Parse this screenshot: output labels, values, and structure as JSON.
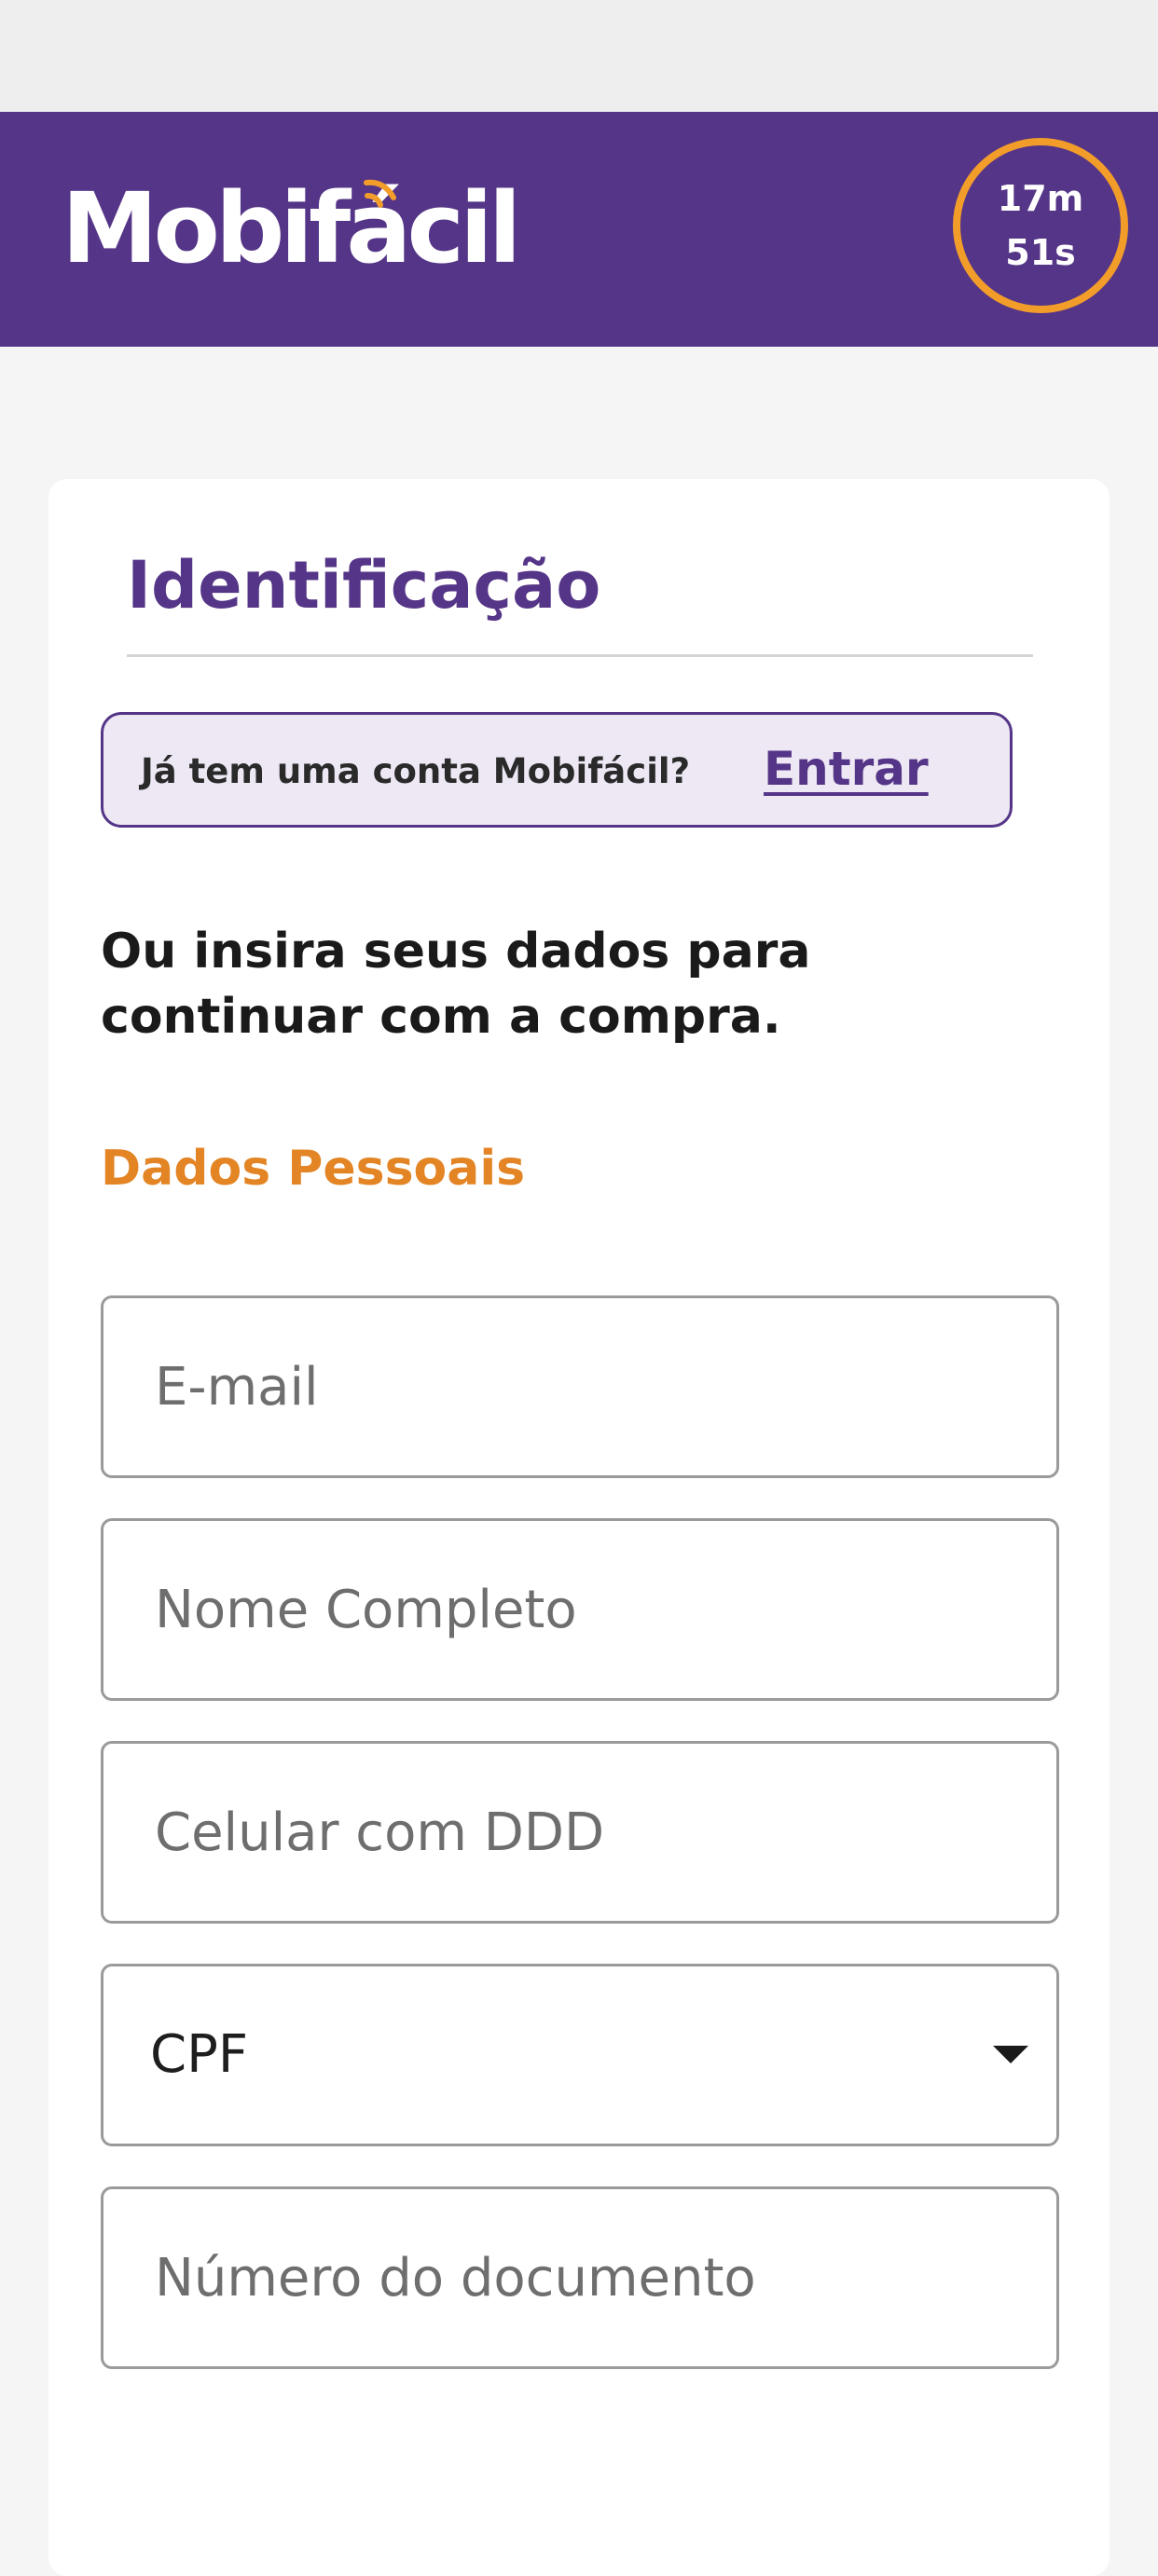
{
  "header": {
    "logo_text": "Mobifácil",
    "timer": {
      "minutes": "17m",
      "seconds": "51s"
    }
  },
  "colors": {
    "brand_purple": "#553587",
    "accent_orange": "#e38525",
    "timer_ring": "#f29d2a"
  },
  "page": {
    "title": "Identificação",
    "login_prompt": {
      "question": "Já tem uma conta Mobifácil?",
      "link_label": "Entrar"
    },
    "subtitle": "Ou insira seus dados para continuar com a compra.",
    "section_label": "Dados Pessoais"
  },
  "form": {
    "email": {
      "placeholder": "E-mail",
      "value": ""
    },
    "full_name": {
      "placeholder": "Nome Completo",
      "value": ""
    },
    "phone": {
      "placeholder": "Celular com DDD",
      "value": ""
    },
    "document_type": {
      "selected": "CPF"
    },
    "document_number": {
      "placeholder": "Número do documento",
      "value": ""
    }
  }
}
